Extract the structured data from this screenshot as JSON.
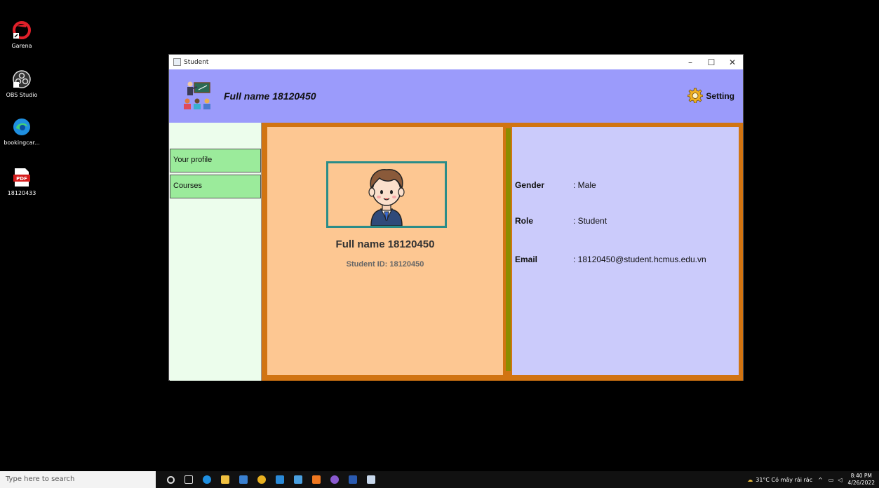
{
  "desktop": {
    "icons": [
      {
        "label": "Garena",
        "icon": "garena-icon"
      },
      {
        "label": "OBS Studio",
        "icon": "obs-icon"
      },
      {
        "label": "bookingcar...",
        "icon": "edge-icon"
      },
      {
        "label": "18120433",
        "icon": "pdf-icon",
        "badge": "PDF"
      }
    ]
  },
  "window": {
    "title": "Student",
    "controls": {
      "minimize": "–",
      "maximize": "☐",
      "close": "✕"
    }
  },
  "header": {
    "full_name": "Full name 18120450",
    "setting_label": "Setting"
  },
  "sidebar": {
    "items": [
      {
        "label": "Your profile"
      },
      {
        "label": "Courses"
      }
    ]
  },
  "profile": {
    "full_name": "Full name 18120450",
    "student_id": "Student ID: 18120450"
  },
  "info": {
    "gender_label": "Gender",
    "gender_value": ": Male",
    "role_label": "Role",
    "role_value": ": Student",
    "email_label": "Email",
    "email_value": ": 18120450@student.hcmus.edu.vn"
  },
  "taskbar": {
    "search_placeholder": "Type here to search",
    "weather": "31°C  Có mây rải rác",
    "time": "8:40 PM",
    "date": "4/26/2022"
  },
  "colors": {
    "header_bg": "#9b9bfb",
    "sidebar_bg": "#ecfdec",
    "nav_item_bg": "#9beb9b",
    "main_border": "#d17412",
    "profile_bg": "#fdc792",
    "info_bg": "#cbcbfb",
    "divider": "#8c8c00",
    "avatar_border": "#2a8c88"
  }
}
